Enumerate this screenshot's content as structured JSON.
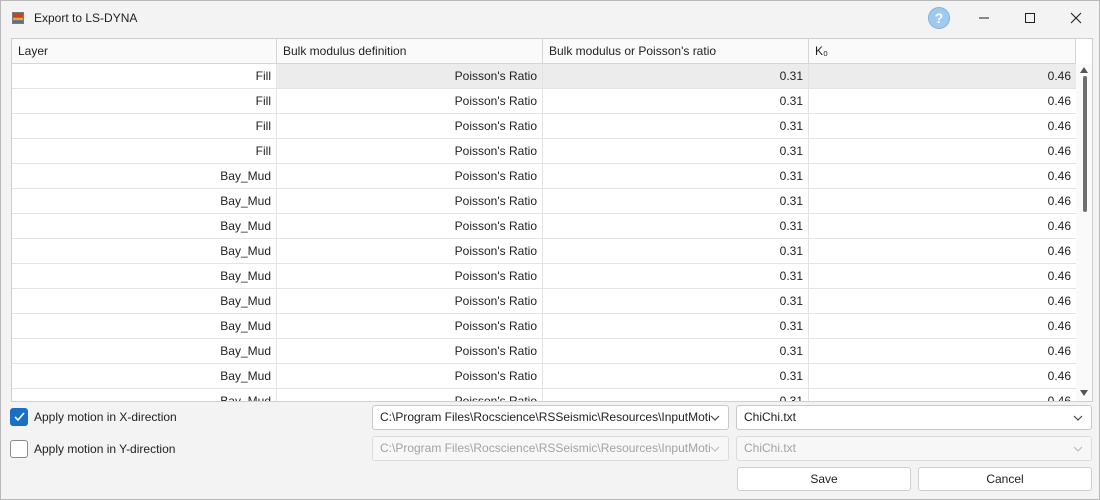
{
  "window": {
    "title": "Export to LS-DYNA",
    "help_label": "?"
  },
  "table": {
    "headers": [
      "Layer",
      "Bulk modulus definition",
      "Bulk modulus or Poisson's ratio",
      "K₀"
    ],
    "rows": [
      [
        "Fill",
        "Poisson's Ratio",
        "0.31",
        "0.46"
      ],
      [
        "Fill",
        "Poisson's Ratio",
        "0.31",
        "0.46"
      ],
      [
        "Fill",
        "Poisson's Ratio",
        "0.31",
        "0.46"
      ],
      [
        "Fill",
        "Poisson's Ratio",
        "0.31",
        "0.46"
      ],
      [
        "Bay_Mud",
        "Poisson's Ratio",
        "0.31",
        "0.46"
      ],
      [
        "Bay_Mud",
        "Poisson's Ratio",
        "0.31",
        "0.46"
      ],
      [
        "Bay_Mud",
        "Poisson's Ratio",
        "0.31",
        "0.46"
      ],
      [
        "Bay_Mud",
        "Poisson's Ratio",
        "0.31",
        "0.46"
      ],
      [
        "Bay_Mud",
        "Poisson's Ratio",
        "0.31",
        "0.46"
      ],
      [
        "Bay_Mud",
        "Poisson's Ratio",
        "0.31",
        "0.46"
      ],
      [
        "Bay_Mud",
        "Poisson's Ratio",
        "0.31",
        "0.46"
      ],
      [
        "Bay_Mud",
        "Poisson's Ratio",
        "0.31",
        "0.46"
      ],
      [
        "Bay_Mud",
        "Poisson's Ratio",
        "0.31",
        "0.46"
      ],
      [
        "Bay_Mud",
        "Poisson's Ratio",
        "0.31",
        "0.46"
      ]
    ]
  },
  "motion_x": {
    "label": "Apply motion in X-direction",
    "checked": true,
    "path": "C:\\Program Files\\Rocscience\\RSSeismic\\Resources\\InputMoti",
    "file": "ChiChi.txt"
  },
  "motion_y": {
    "label": "Apply motion in Y-direction",
    "checked": false,
    "path": "C:\\Program Files\\Rocscience\\RSSeismic\\Resources\\InputMoti",
    "file": "ChiChi.txt"
  },
  "buttons": {
    "save": "Save",
    "cancel": "Cancel"
  },
  "colors": {
    "accent": "#1a6fc4",
    "help": "#9fcaf0",
    "app_icon": "#c0432c"
  }
}
